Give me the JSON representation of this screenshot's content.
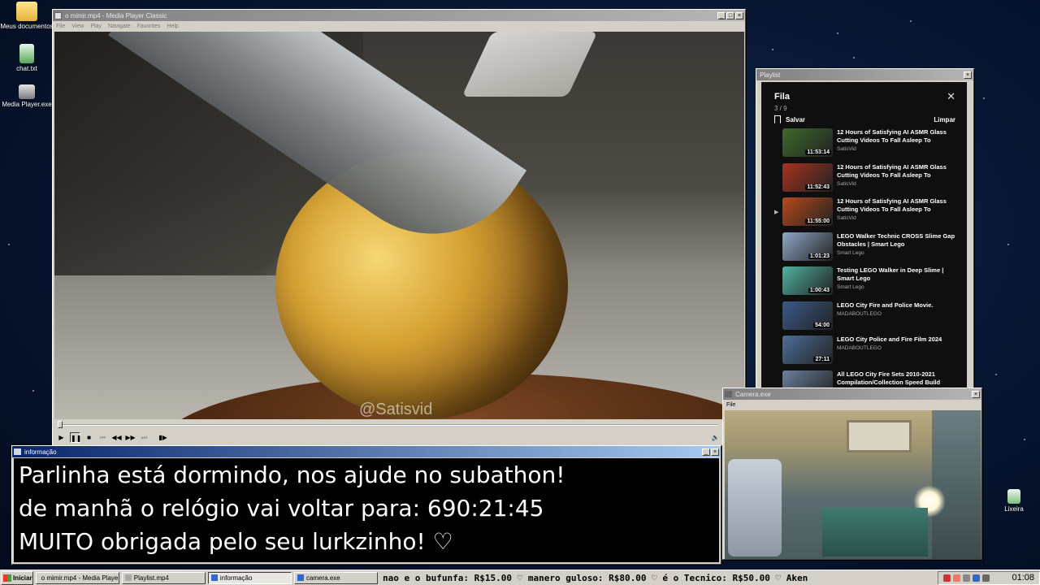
{
  "desktop": {
    "icons": [
      {
        "label": "Meus documentos"
      },
      {
        "label": "chat.txt"
      },
      {
        "label": "Media Player.exe"
      },
      {
        "label": "Lixeira"
      }
    ]
  },
  "player": {
    "title": "o mimir.mp4 - Media Player Classic",
    "menu": [
      "File",
      "View",
      "Play",
      "Navigate",
      "Favorites",
      "Help"
    ],
    "watermark": "@Satisvid",
    "controls": [
      "play",
      "pause",
      "stop",
      "skip-back",
      "rewind",
      "forward",
      "skip-forward",
      "frame-step"
    ]
  },
  "playlist_window": {
    "title": "Playlist",
    "header": "Fila",
    "count": "3 / 9",
    "save_label": "Salvar",
    "clear_label": "Limpar",
    "items": [
      {
        "title": "12 Hours of Satisfying AI ASMR Glass Cutting Videos To Fall Asleep To",
        "channel": "SatisVid",
        "duration": "11:53:14",
        "color": "#3d6b2a",
        "current": false
      },
      {
        "title": "12 Hours of Satisfying AI ASMR Glass Cutting Videos To Fall Asleep To",
        "channel": "SatisVid",
        "duration": "11:52:43",
        "color": "#a8321e",
        "current": false
      },
      {
        "title": "12 Hours of Satisfying AI ASMR Glass Cutting Videos To Fall Asleep To",
        "channel": "SatisVid",
        "duration": "11:55:00",
        "color": "#b84a1c",
        "current": true
      },
      {
        "title": "LEGO Walker Technic CROSS Slime Gap Obstacles | Smart Lego",
        "channel": "Smart Lego",
        "duration": "1:01:23",
        "color": "#8fa7c9",
        "current": false
      },
      {
        "title": "Testing LEGO Walker in Deep Slime | Smart Lego",
        "channel": "Smart Lego",
        "duration": "1:00:43",
        "color": "#4fb3a0",
        "current": false
      },
      {
        "title": "LEGO City Fire and Police Movie.",
        "channel": "MADABOUTLEGO",
        "duration": "54:00",
        "color": "#3b5a8a",
        "current": false
      },
      {
        "title": "LEGO City Police and Fire Film 2024",
        "channel": "MADABOUTLEGO",
        "duration": "27:11",
        "color": "#4d6f99",
        "current": false
      },
      {
        "title": "All LEGO City Fire Sets 2010-2021 Compilation/Collection Speed Build",
        "channel": "",
        "duration": "",
        "color": "#6b7f9c",
        "current": false
      }
    ]
  },
  "camera_window": {
    "title": "Camera.exe",
    "menu": [
      "File"
    ]
  },
  "info_window": {
    "title": "informação",
    "lines": [
      "Parlinha está dormindo, nos ajude no subathon!",
      "de manhã o relógio vai voltar para:  690:21:45",
      "MUITO obrigada pelo seu lurkzinho! ♡"
    ]
  },
  "taskbar": {
    "start_label": "Iniciar",
    "tasks": [
      {
        "label": "o mimir.mp4 - Media Playe...",
        "active": false
      },
      {
        "label": "Playlist.mp4",
        "active": false
      },
      {
        "label": "informação",
        "active": true
      },
      {
        "label": "camera.exe",
        "active": false
      }
    ],
    "ticker": "nao e o bufunfa: R$15.00   ♡ manero guloso: R$80.00   ♡ é o Tecnico: R$50.00   ♡ Aken",
    "clock": "01:08"
  }
}
